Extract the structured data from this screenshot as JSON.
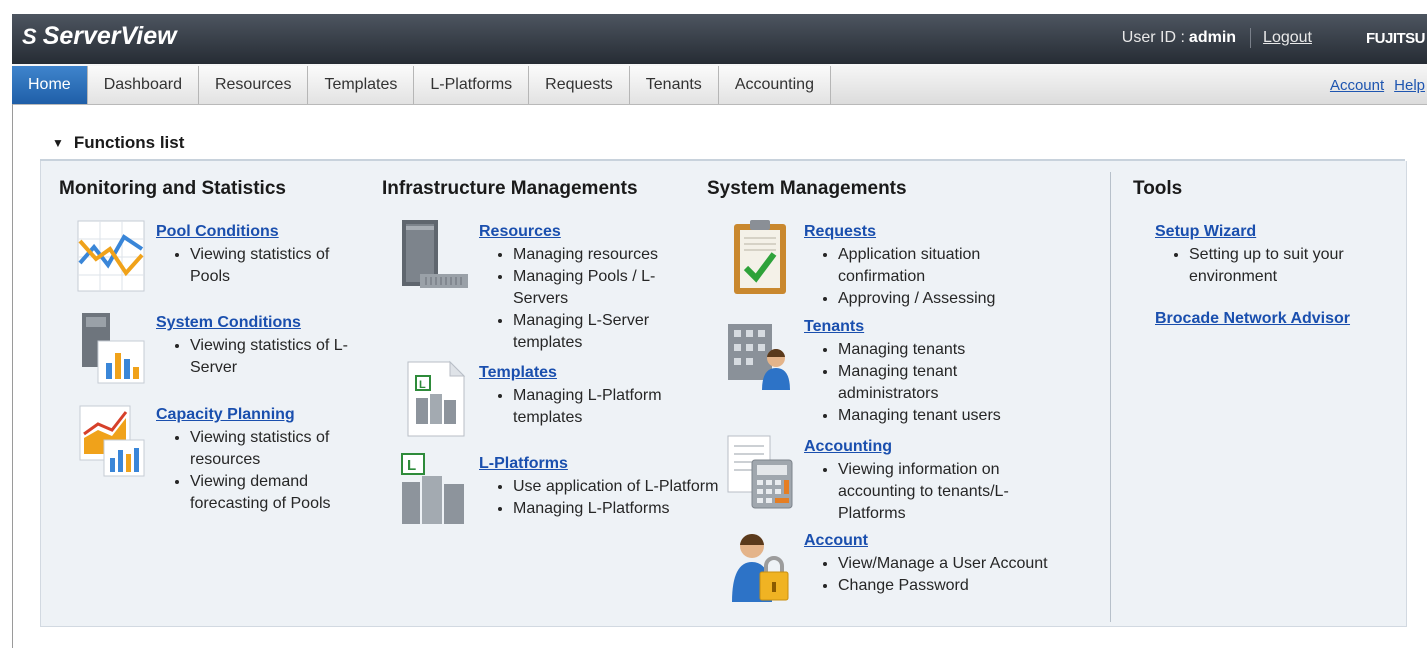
{
  "header": {
    "app_name": "ServerView",
    "logo_mark": "S",
    "user_id_label": "User ID :",
    "user_name": "admin",
    "logout_label": "Logout",
    "brand": "FUJITSU"
  },
  "tabs": [
    {
      "label": "Home",
      "active": true
    },
    {
      "label": "Dashboard"
    },
    {
      "label": "Resources"
    },
    {
      "label": "Templates"
    },
    {
      "label": "L-Platforms"
    },
    {
      "label": "Requests"
    },
    {
      "label": "Tenants"
    },
    {
      "label": "Accounting"
    }
  ],
  "tab_links": {
    "account": "Account",
    "help": "Help"
  },
  "functions": {
    "toggle_icon": "▼",
    "title": "Functions list",
    "columns": [
      {
        "title": "Monitoring and Statistics",
        "items": [
          {
            "link": "Pool Conditions",
            "icon": "line-chart-icon",
            "bullets": [
              "Viewing statistics of Pools"
            ]
          },
          {
            "link": "System Conditions",
            "icon": "server-chart-icon",
            "bullets": [
              "Viewing statistics of L-Server"
            ]
          },
          {
            "link": "Capacity Planning",
            "icon": "capacity-chart-icon",
            "bullets": [
              "Viewing statistics of resources",
              "Viewing demand forecasting of Pools"
            ]
          }
        ]
      },
      {
        "title": "Infrastructure Managements",
        "items": [
          {
            "link": "Resources",
            "icon": "server-tower-icon",
            "bullets": [
              "Managing resources",
              "Managing Pools / L-Servers",
              "Managing L-Server templates"
            ]
          },
          {
            "link": "Templates",
            "icon": "template-document-icon",
            "bullets": [
              "Managing L-Platform templates"
            ]
          },
          {
            "link": "L-Platforms",
            "icon": "l-platform-icon",
            "bullets": [
              "Use application of L-Platform",
              "Managing L-Platforms"
            ]
          }
        ]
      },
      {
        "title": "System Managements",
        "items": [
          {
            "link": "Requests",
            "icon": "clipboard-check-icon",
            "bullets": [
              "Application situation confirmation",
              "Approving / Assessing"
            ]
          },
          {
            "link": "Tenants",
            "icon": "building-user-icon",
            "bullets": [
              "Managing tenants",
              "Managing tenant administrators",
              "Managing tenant users"
            ]
          },
          {
            "link": "Accounting",
            "icon": "calculator-icon",
            "bullets": [
              "Viewing information on accounting to tenants/L-Platforms"
            ]
          },
          {
            "link": "Account",
            "icon": "user-lock-icon",
            "bullets": [
              "View/Manage a User Account",
              "Change Password"
            ]
          }
        ]
      },
      {
        "title": "Tools",
        "items": [
          {
            "link": "Setup Wizard",
            "bullets": [
              "Setting up to suit your environment"
            ]
          },
          {
            "link": "Brocade Network Advisor",
            "bullets": []
          }
        ]
      }
    ]
  },
  "colors": {
    "header": "#2f353d",
    "tab_active": "#2a6fb8",
    "link": "#1a4fae",
    "panel": "#eef2f6"
  }
}
